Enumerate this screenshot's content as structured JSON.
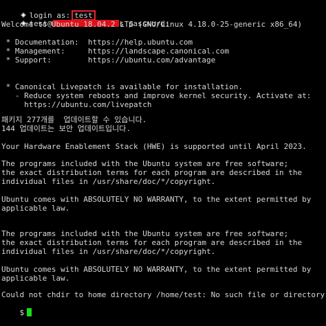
{
  "login_prefix": "login as:",
  "login_user": "test",
  "password_user": "test@",
  "password_suffix": "s password:",
  "welcome": "Welcome to Ubuntu 18.04.2 LTS (GNU/Linux 4.18.0-25-generic x86_64)",
  "links": {
    "documentation": " * Documentation:  https://help.ubuntu.com",
    "management": " * Management:     https://landscape.canonical.com",
    "support": " * Support:        https://ubuntu.com/advantage"
  },
  "livepatch": {
    "line1": " * Canonical Livepatch is available for installation.",
    "line2": "   - Reduce system reboots and improve kernel security. Activate at:",
    "line3": "     https://ubuntu.com/livepatch"
  },
  "updates": {
    "packages": "패키지 277개를  업데이트할 수 있습니다.",
    "security": "144 업데이트는 보안 업데이트입니다."
  },
  "hwe": "Your Hardware Enablement Stack (HWE) is supported until April 2023.",
  "legal1": {
    "line1": "The programs included with the Ubuntu system are free software;",
    "line2": "the exact distribution terms for each program are described in the",
    "line3": "individual files in /usr/share/doc/*/copyright."
  },
  "warranty1": {
    "line1": "Ubuntu comes with ABSOLUTELY NO WARRANTY, to the extent permitted by",
    "line2": "applicable law."
  },
  "legal2": {
    "line1": "The programs included with the Ubuntu system are free software;",
    "line2": "the exact distribution terms for each program are described in the",
    "line3": "individual files in /usr/share/doc/*/copyright."
  },
  "warranty2": {
    "line1": "Ubuntu comes with ABSOLUTELY NO WARRANTY, to the extent permitted by",
    "line2": "applicable law."
  },
  "chdir_error": "Could not chdir to home directory /home/test: No such file or directory",
  "prompt": "$",
  "colors": {
    "background": "#000000",
    "text": "#d8d8d8",
    "highlight_box": "#e22233",
    "redaction": "#e0101a",
    "cursor": "#18e018"
  }
}
